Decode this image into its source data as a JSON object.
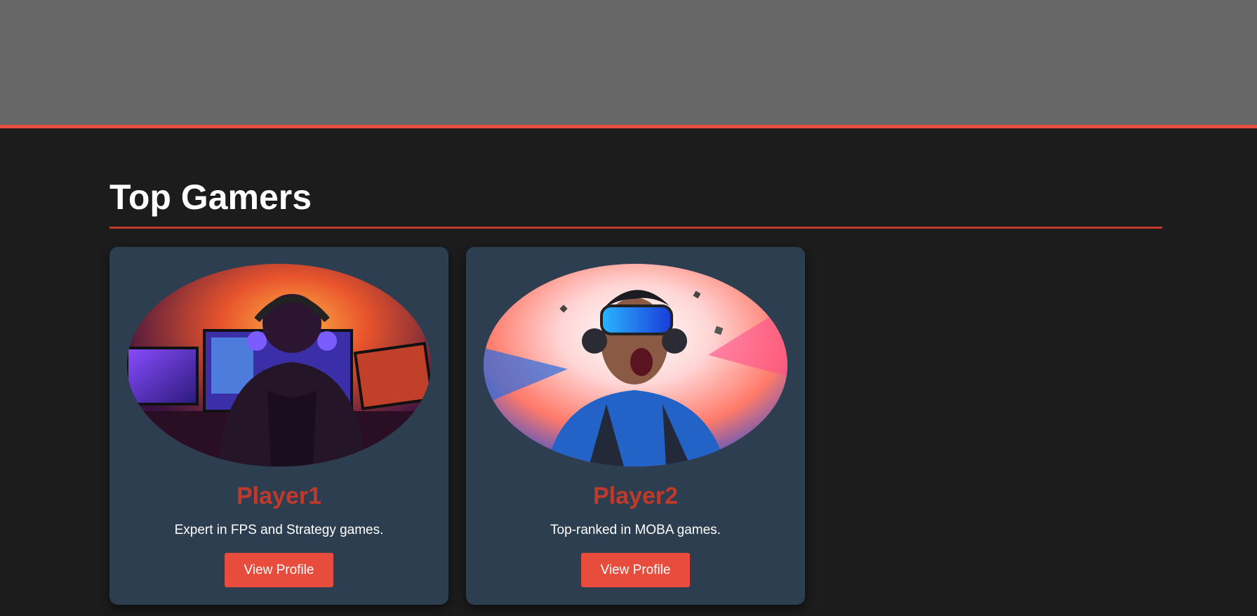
{
  "section": {
    "title": "Top Gamers"
  },
  "players": [
    {
      "name": "Player1",
      "description": "Expert in FPS and Strategy games.",
      "button_label": "View Profile"
    },
    {
      "name": "Player2",
      "description": "Top-ranked in MOBA games.",
      "button_label": "View Profile"
    }
  ],
  "colors": {
    "accent": "#e74c3c",
    "name": "#c0392b",
    "card_bg": "#2c3e50",
    "page_bg": "#1c1c1c",
    "header_bg": "#676767"
  }
}
